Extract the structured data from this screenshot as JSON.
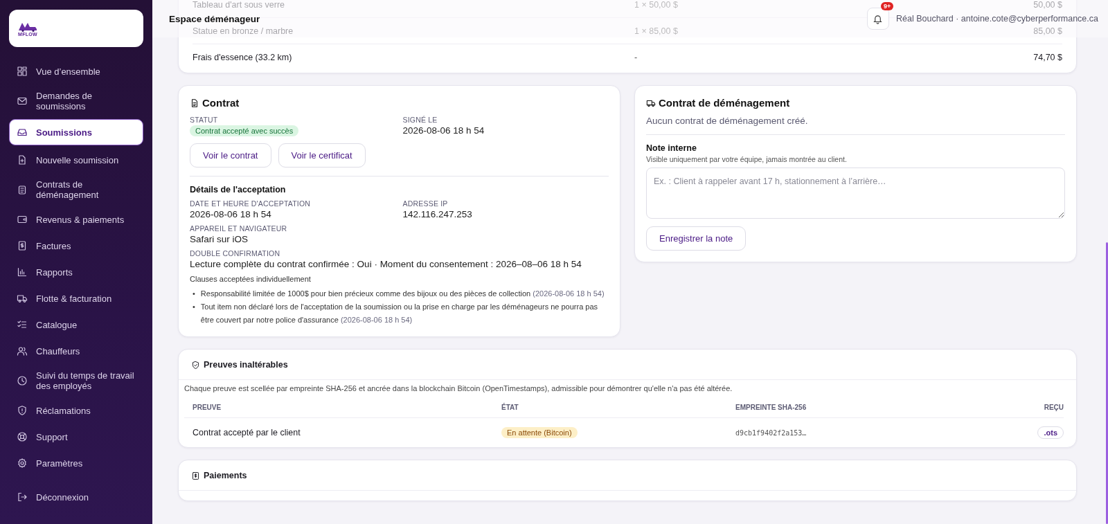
{
  "sidebar": {
    "logo_text": "MFLOW",
    "items": [
      {
        "label": "Vue d’ensemble",
        "selected": false
      },
      {
        "label": "Demandes de soumissions",
        "selected": false
      },
      {
        "label": "Soumissions",
        "selected": true
      },
      {
        "label": "Nouvelle soumission",
        "selected": false
      },
      {
        "label": "Contrats de déménagement",
        "selected": false
      },
      {
        "label": "Revenus & paiements",
        "selected": false
      },
      {
        "label": "Factures",
        "selected": false
      },
      {
        "label": "Rapports",
        "selected": false
      },
      {
        "label": "Flotte & facturation",
        "selected": false
      },
      {
        "label": "Catalogue",
        "selected": false
      },
      {
        "label": "Chauffeurs",
        "selected": false
      },
      {
        "label": "Suivi du temps de travail des employés",
        "selected": false
      },
      {
        "label": "Réclamations",
        "selected": false
      },
      {
        "label": "Support",
        "selected": false
      },
      {
        "label": "Paramètres",
        "selected": false
      }
    ],
    "logout": "Déconnexion"
  },
  "header": {
    "title": "Espace déménageur",
    "notification_badge": "9+",
    "user": "Réal Bouchard · antoine.cote@cyberperformance.ca"
  },
  "charges": {
    "rows": [
      {
        "item": "Tableau d'art sous verre",
        "quantity": "1 × 50,00 $",
        "amount": "50,00 $"
      },
      {
        "item": "Statue en bronze / marbre",
        "quantity": "1 × 85,00 $",
        "amount": "85,00 $"
      },
      {
        "item": "Frais d'essence (33.2 km)",
        "quantity": "-",
        "amount": "74,70 $"
      }
    ]
  },
  "contract": {
    "title": "Contrat",
    "status_label": "STATUT",
    "status": {
      "text": "Contrat accepté avec succès",
      "kind": "success"
    },
    "signed_label": "SIGNÉ LE",
    "signed_value": "2026-08-06 18 h 54",
    "buttons": [
      "Voir le contrat",
      "Voir le certificat"
    ],
    "details_title": "Détails de l'acceptation",
    "field_rows": [
      [
        {
          "label": "DATE ET HEURE D'ACCEPTATION",
          "value": "2026-08-06 18 h 54"
        },
        {
          "label": "ADRESSE IP",
          "value": "142.116.247.253"
        }
      ],
      [
        {
          "label": "APPAREIL ET NAVIGATEUR",
          "value": "Safari sur iOS"
        }
      ],
      [
        {
          "label": "DOUBLE CONFIRMATION",
          "value": "Lecture complète du contrat confirmée : Oui · Moment du consentement : 2026–08–06 18 h 54"
        }
      ]
    ],
    "clauses_label": "Clauses acceptées individuellement",
    "clauses": [
      {
        "bullet": "•",
        "text": "Responsabilité limitée de 1000$ pour bien précieux comme des bijoux ou des pièces de collection",
        "date": "(2026-08-06 18 h 54)"
      },
      {
        "bullet": "•",
        "text": "Tout item non déclaré lors de l'acceptation de la soumission ou la prise en charge par les déménageurs ne pourra pas être couvert par notre police d'assurance",
        "date": "(2026-08-06 18 h 54)"
      }
    ]
  },
  "moving_contract": {
    "title": "Contrat de déménagement",
    "empty_text": "Aucun contrat de déménagement créé.",
    "note_title": "Note interne",
    "note_hint": "Visible uniquement par votre équipe, jamais montrée au client.",
    "note_placeholder": "Ex. : Client à rappeler avant 17 h, stationnement à l’arrière…",
    "save_button": "Enregistrer la note"
  },
  "proofs": {
    "title": "Preuves inaltérables",
    "description": "Chaque preuve est scellée par empreinte SHA-256 et ancrée dans la blockchain Bitcoin (OpenTimestamps), admissible pour démontrer qu'elle n'a pas été altérée.",
    "columns": [
      "PREUVE",
      "ÉTAT",
      "EMPREINTE SHA-256",
      "REÇU"
    ],
    "rows": [
      {
        "proof": "Contrat accepté par le client",
        "status": {
          "text": "En attente (Bitcoin)",
          "kind": "pending"
        },
        "hash": "d9cb1f9402f2a153…",
        "receipt": ".ots"
      }
    ]
  },
  "payments": {
    "title": "Paiements"
  }
}
